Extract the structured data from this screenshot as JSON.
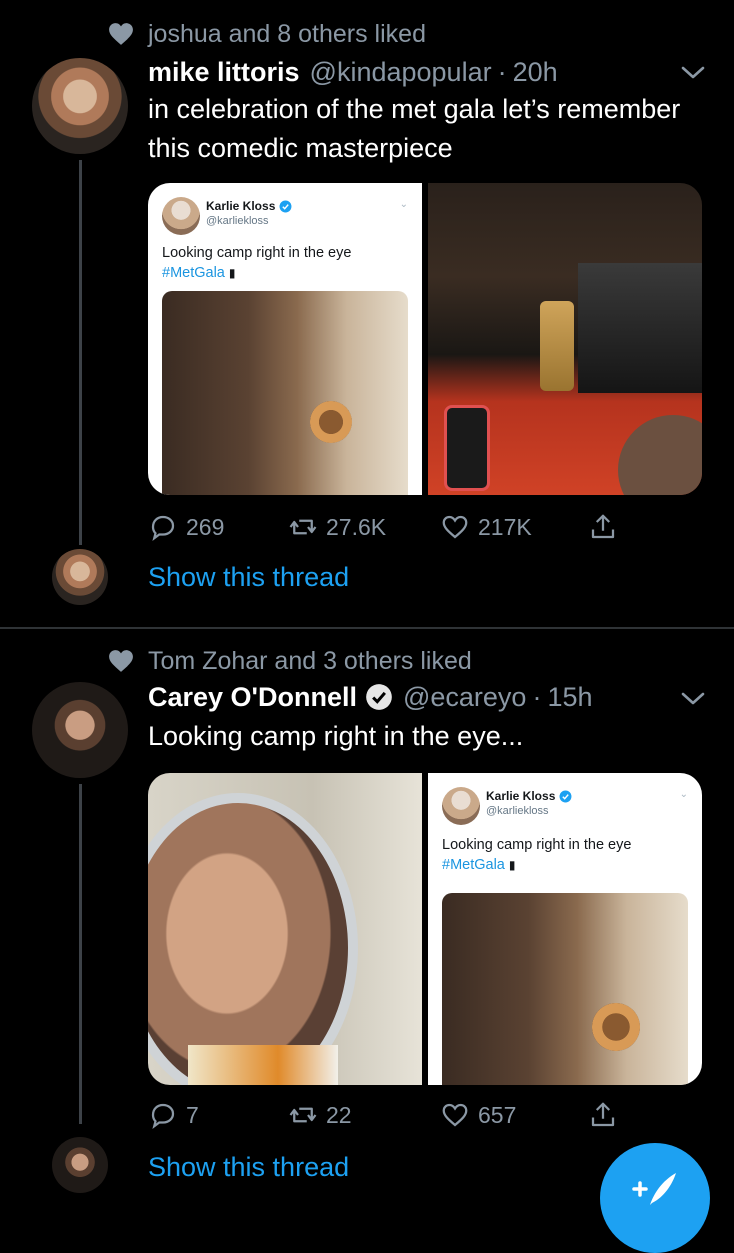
{
  "tweets": [
    {
      "social_context": "joshua and 8 others liked",
      "display_name": "mike littoris",
      "handle": "@kindapopular",
      "separator": "·",
      "time": "20h",
      "text": "in celebration of the met gala let’s remember this comedic masterpiece",
      "embedded_card": {
        "name": "Karlie Kloss",
        "handle": "@karliekloss",
        "text": "Looking camp right in the eye",
        "hashtag": "#MetGala"
      },
      "actions": {
        "replies": "269",
        "retweets": "27.6K",
        "likes": "217K"
      },
      "show_thread": "Show this thread"
    },
    {
      "social_context": "Tom Zohar and 3 others liked",
      "display_name": "Carey O'Donnell",
      "handle": "@ecareyo",
      "separator": "·",
      "time": "15h",
      "text": "Looking camp right in the eye...",
      "embedded_card": {
        "name": "Karlie Kloss",
        "handle": "@karliekloss",
        "text": "Looking camp right in the eye",
        "hashtag": "#MetGala"
      },
      "actions": {
        "replies": "7",
        "retweets": "22",
        "likes": "657"
      },
      "show_thread": "Show this thread"
    }
  ],
  "colors": {
    "background": "#000000",
    "secondary_text": "#8b98a5",
    "link": "#1da1f2",
    "fab": "#1da1f2"
  },
  "icons": [
    "heart-icon",
    "verified-badge-icon",
    "chevron-down-icon",
    "reply-icon",
    "retweet-icon",
    "like-icon",
    "share-icon",
    "compose-icon"
  ]
}
